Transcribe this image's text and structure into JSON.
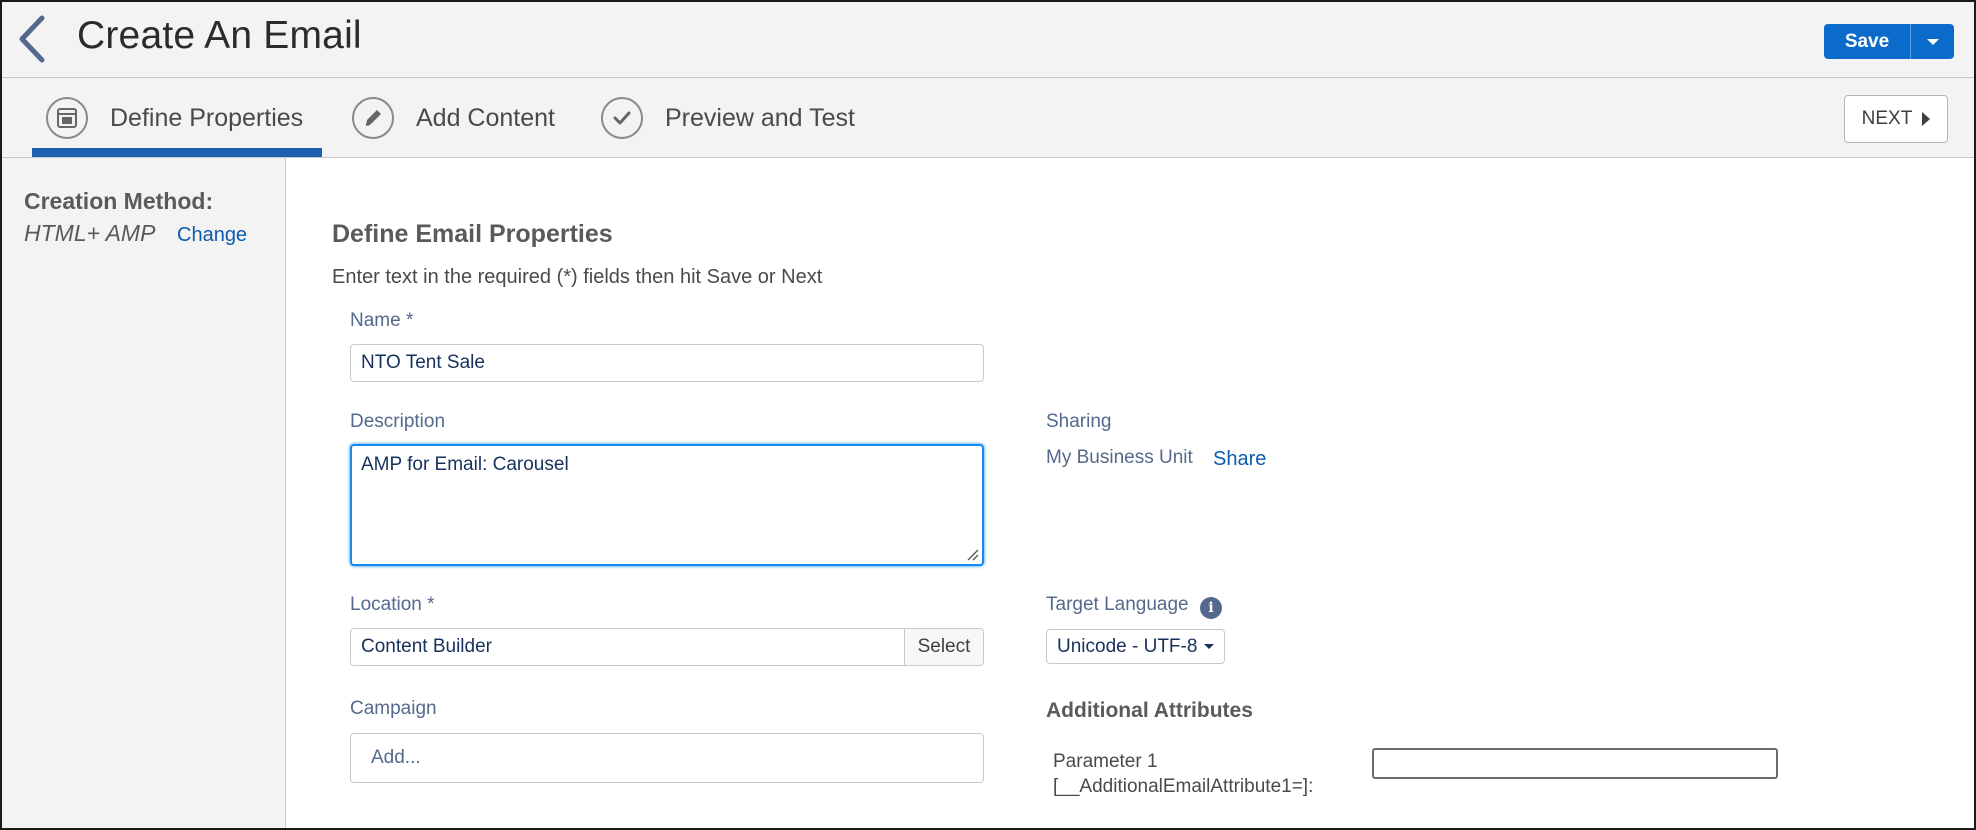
{
  "header": {
    "title": "Create An Email",
    "save_label": "Save"
  },
  "steps": {
    "items": [
      {
        "label": "Define Properties",
        "icon": "layout-icon",
        "active": true
      },
      {
        "label": "Add Content",
        "icon": "pencil-icon",
        "active": false
      },
      {
        "label": "Preview and Test",
        "icon": "checkmark-icon",
        "active": false
      }
    ],
    "next_label": "NEXT"
  },
  "sidebar": {
    "creation_method_label": "Creation Method:",
    "creation_method_value": "HTML+ AMP",
    "change_link": "Change"
  },
  "form": {
    "title": "Define Email Properties",
    "subtitle": "Enter text in the required (*) fields then hit Save or Next",
    "name_label": "Name *",
    "name_value": "NTO Tent Sale",
    "description_label": "Description",
    "description_value": "AMP for Email: Carousel",
    "location_label": "Location *",
    "location_value": "Content Builder",
    "location_select": "Select",
    "campaign_label": "Campaign",
    "campaign_placeholder": "Add...",
    "sharing_label": "Sharing",
    "sharing_value": "My Business Unit",
    "share_link": "Share",
    "target_language_label": "Target Language",
    "target_language_value": "Unicode - UTF-8",
    "info_icon_glyph": "i",
    "additional_attributes_title": "Additional Attributes",
    "parameter_label_line1": "Parameter 1",
    "parameter_label_line2": "[__AdditionalEmailAttribute1=]:",
    "parameter_value": ""
  },
  "colors": {
    "accent": "#0b6bcb",
    "active_step_bar": "#1f5fad",
    "link": "#0b5cad",
    "focus": "#1589ee"
  }
}
